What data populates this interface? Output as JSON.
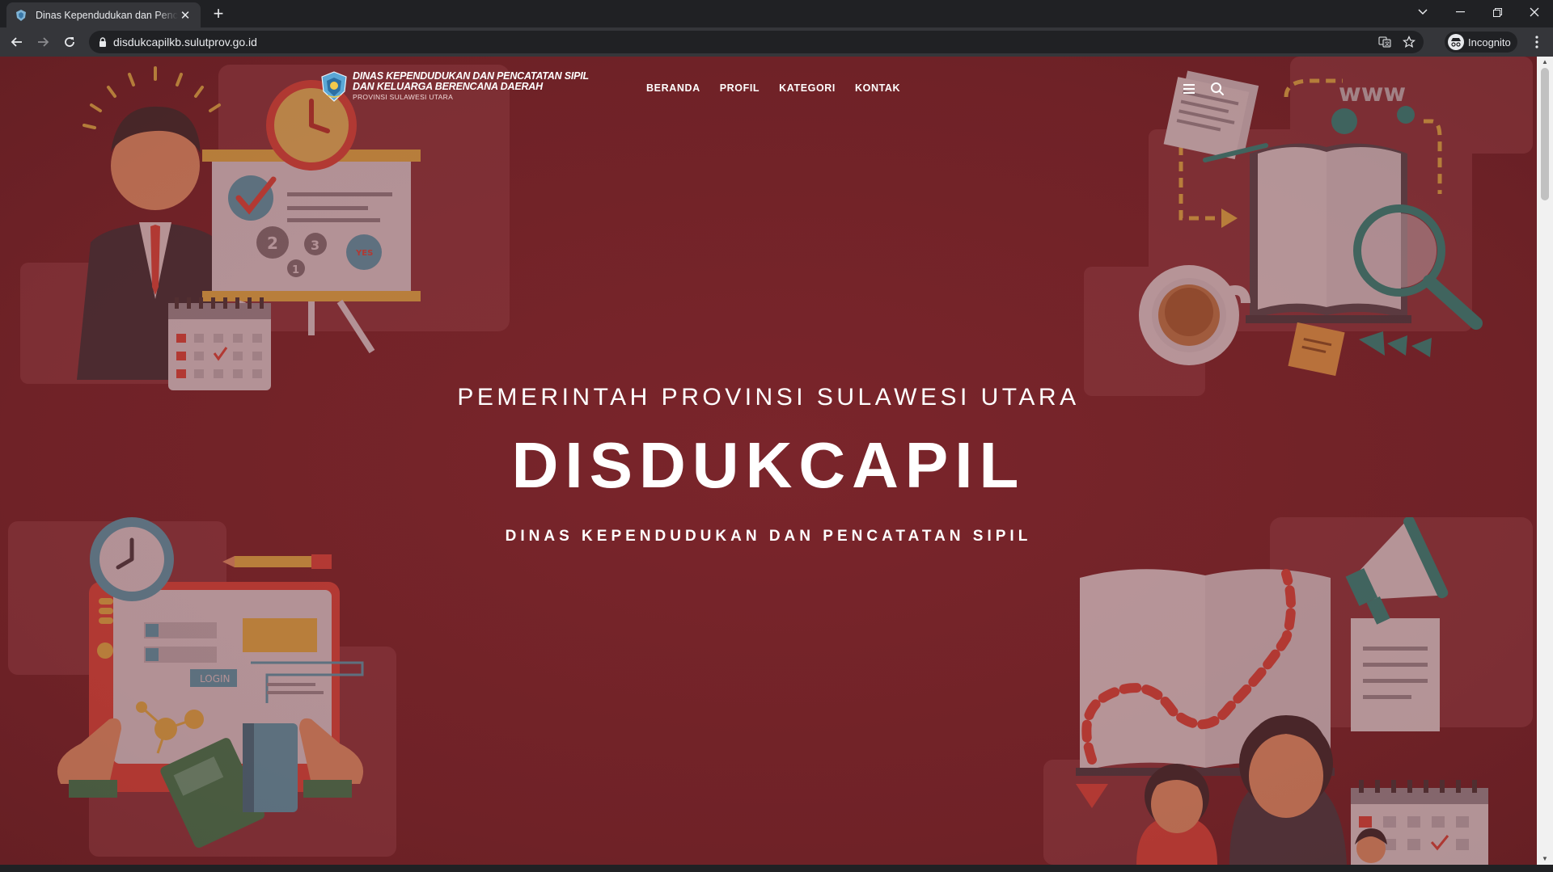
{
  "browser": {
    "tab_title": "Dinas Kependudukan dan Pencatatan Sipil",
    "url": "disdukcapilkb.sulutprov.go.id",
    "incognito_label": "Incognito"
  },
  "site": {
    "logo_line1": "DINAS KEPENDUDUKAN DAN PENCATATAN SIPIL",
    "logo_line2": "DAN KELUARGA BERENCANA DAERAH",
    "logo_line3": "PROVINSI SULAWESI UTARA",
    "nav": [
      "BERANDA",
      "PROFIL",
      "KATEGORI",
      "KONTAK"
    ]
  },
  "hero": {
    "pre_title": "PEMERINTAH PROVINSI SULAWESI UTARA",
    "title": "DISDUKCAPIL",
    "subtitle": "DINAS KEPENDUDUKAN DAN PENCATATAN SIPIL"
  },
  "illustration_labels": {
    "www": "www",
    "yes": "YES",
    "login": "LOGIN",
    "n1": "1",
    "n2": "2",
    "n3": "3"
  },
  "colors": {
    "hero_bg": "#74242a",
    "chrome_dark": "#202124",
    "chrome_mid": "#35363a"
  }
}
